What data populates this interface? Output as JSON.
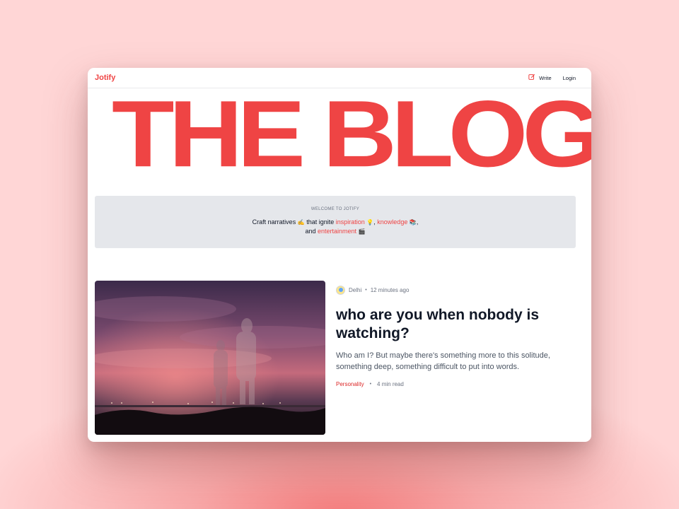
{
  "app": {
    "brand": "Jotify"
  },
  "nav": {
    "write_label": "Write",
    "login_label": "Login"
  },
  "hero": {
    "title": "THE BLOG"
  },
  "welcome": {
    "label": "WELCOME TO JOTIFY",
    "line1_prefix": "Craft narratives",
    "emoji_write": "✍️",
    "line1_mid": "that ignite",
    "word_inspiration": "inspiration",
    "emoji_bulb": "💡",
    "comma1": ",",
    "word_knowledge": "knowledge",
    "emoji_books": "📚",
    "comma2": ",",
    "line2_prefix": "and",
    "word_entertainment": "entertainment",
    "emoji_clapper": "🎬"
  },
  "post": {
    "author": "Delhi",
    "dot": "•",
    "time": "12 minutes ago",
    "title": "who are you when nobody is watching?",
    "excerpt": "Who am I? But maybe there's something more to this solitude, something deep, something difficult to put into words.",
    "category": "Personality",
    "read_time": "4 min read"
  },
  "colors": {
    "accent": "#ef4444",
    "text": "#111827",
    "muted": "#6b7280",
    "banner_bg": "#e5e7eb"
  },
  "icons": {
    "write": "edit-square-icon",
    "avatar": "avatar-globe-icon"
  }
}
